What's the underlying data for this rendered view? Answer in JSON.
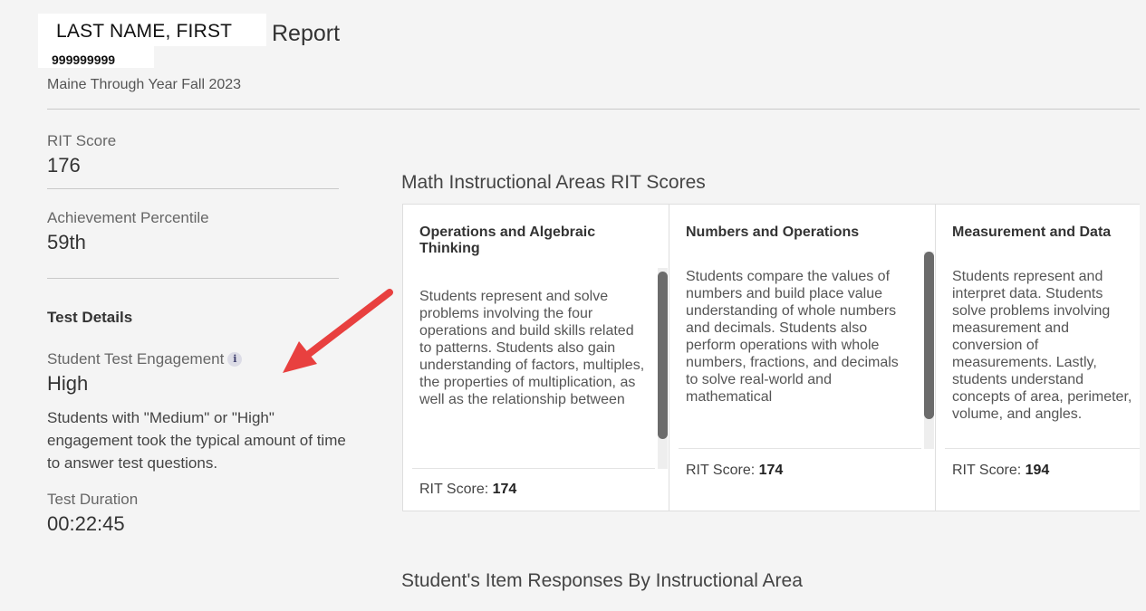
{
  "header": {
    "student_name": "LAST NAME, FIRST",
    "report_label": "Report",
    "student_id": "999999999",
    "term": "Maine Through Year Fall 2023"
  },
  "summary": {
    "rit_label": "RIT Score",
    "rit_value": "176",
    "percentile_label": "Achievement Percentile",
    "percentile_value": "59th"
  },
  "test_details": {
    "title": "Test Details",
    "engagement_label": "Student Test Engagement",
    "engagement_info_icon": "i",
    "engagement_value": "High",
    "engagement_desc": "Students with \"Medium\" or \"High\" engagement took the typical amount of time to answer test questions.",
    "duration_label": "Test Duration",
    "duration_value": "00:22:45"
  },
  "instructional_areas": {
    "heading": "Math Instructional Areas RIT Scores",
    "score_label": "RIT Score:",
    "cards": [
      {
        "title": "Operations and Algebraic Thinking",
        "description": "Students represent and solve problems involving the four operations and build skills related to patterns. Students also gain understanding of factors, multiples, the properties of multiplication, as well as the relationship between",
        "score": "174",
        "scroll_position": 0.1
      },
      {
        "title": "Numbers and Operations",
        "description": "Students compare the values of numbers and build place value understanding of whole numbers and decimals. Students also perform operations with whole numbers, fractions, and decimals to solve real-world and mathematical",
        "score": "174",
        "scroll_position": 0.0
      },
      {
        "title": "Measurement and Data",
        "description": "Students represent and interpret data. Students solve problems involving measurement and conversion of measurements. Lastly, students understand concepts of area, perimeter, volume, and angles.",
        "score": "194"
      }
    ]
  },
  "item_responses": {
    "heading": "Student's Item Responses By Instructional Area"
  },
  "colors": {
    "background": "#f4f4f4",
    "card_background": "#ffffff",
    "arrow": "#e8403f",
    "scroll_thumb": "#6b6b6b"
  }
}
